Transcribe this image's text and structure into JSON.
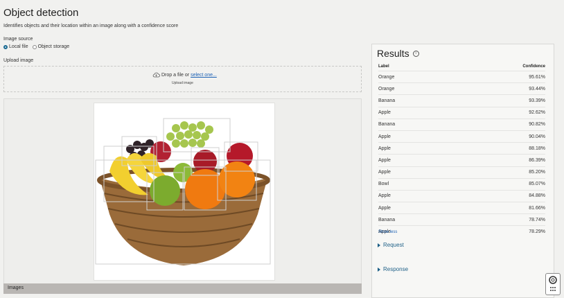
{
  "page": {
    "title": "Object detection",
    "subtitle": "Identifies objects and their location within an image along with a confidence score"
  },
  "image_source": {
    "label": "Image source",
    "options": [
      {
        "label": "Local file",
        "selected": true
      },
      {
        "label": "Object storage",
        "selected": false
      }
    ]
  },
  "upload": {
    "label": "Upload image",
    "drop_text": "Drop a file or",
    "select_link": "select one...",
    "sub_text": "Upload image"
  },
  "images_bar": {
    "label": "Images"
  },
  "results": {
    "title": "Results",
    "col_label": "Label",
    "col_confidence": "Confidence",
    "rows": [
      {
        "label": "Orange",
        "confidence": "95.61%"
      },
      {
        "label": "Orange",
        "confidence": "93.44%"
      },
      {
        "label": "Banana",
        "confidence": "93.39%"
      },
      {
        "label": "Apple",
        "confidence": "92.62%"
      },
      {
        "label": "Banana",
        "confidence": "90.82%"
      },
      {
        "label": "Apple",
        "confidence": "90.04%"
      },
      {
        "label": "Apple",
        "confidence": "88.18%"
      },
      {
        "label": "Apple",
        "confidence": "86.39%"
      },
      {
        "label": "Apple",
        "confidence": "85.20%"
      },
      {
        "label": "Bowl",
        "confidence": "85.07%"
      },
      {
        "label": "Apple",
        "confidence": "84.88%"
      },
      {
        "label": "Apple",
        "confidence": "81.66%"
      },
      {
        "label": "Banana",
        "confidence": "78.74%"
      },
      {
        "label": "Apple",
        "confidence": "78.29%"
      }
    ],
    "show_less": "Show less",
    "request": "Request",
    "response": "Response"
  },
  "colors": {
    "accent": "#1b6a92",
    "link": "#1d62b5"
  },
  "icons": [
    "info-icon",
    "upload-cloud-icon",
    "help-lifebuoy-icon",
    "grid-dots-icon"
  ]
}
